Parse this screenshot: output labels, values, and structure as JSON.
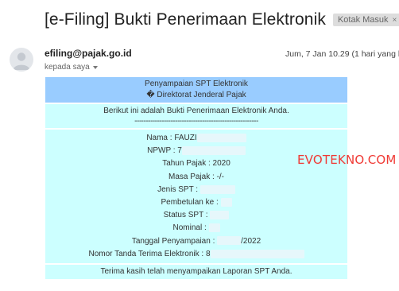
{
  "email": {
    "subject": "[e-Filing] Bukti Penerimaan Elektronik",
    "label": "Kotak Masuk",
    "label_close_glyph": "×",
    "sender_email": "efiling@pajak.go.id",
    "recipient": "kepada saya",
    "date": "Jum, 7 Jan 10.29 (1 hari yang la"
  },
  "receipt": {
    "header_line1": "Penyampaian SPT Elektronik",
    "header_line2": "� Direktorat Jenderal Pajak",
    "intro": "Berikut ini adalah Bukti Penerimaan Elektronik Anda.",
    "separator": "-------------------------------------------------------",
    "details": [
      {
        "text": "Nama : FAUZI",
        "redacted": true
      },
      {
        "text": "NPWP : 7",
        "redacted": true
      },
      {
        "text": "Tahun Pajak : 2020",
        "redacted": false
      },
      {
        "text": "Masa Pajak : -/-",
        "redacted": false
      },
      {
        "text": "Jenis SPT :",
        "redacted": true
      },
      {
        "text": "Pembetulan ke :",
        "redacted": true
      },
      {
        "text": "Status SPT :",
        "redacted": true
      },
      {
        "text": "Nominal :",
        "redacted": true
      },
      {
        "text": "Tanggal Penyampaian :",
        "suffix": "/2022",
        "redacted": true
      },
      {
        "text": "Nomor Tanda Terima Elektronik : 8",
        "redacted": true
      }
    ],
    "thanks": "Terima kasih telah menyampaikan Laporan SPT Anda."
  },
  "watermark": "EVOTEKNO.COM",
  "colors": {
    "header_bg": "#99ccff",
    "body_bg": "#ccffff",
    "label_bg": "#dddddd",
    "watermark": "#f03a35",
    "redaction": "#e6f7fb"
  }
}
